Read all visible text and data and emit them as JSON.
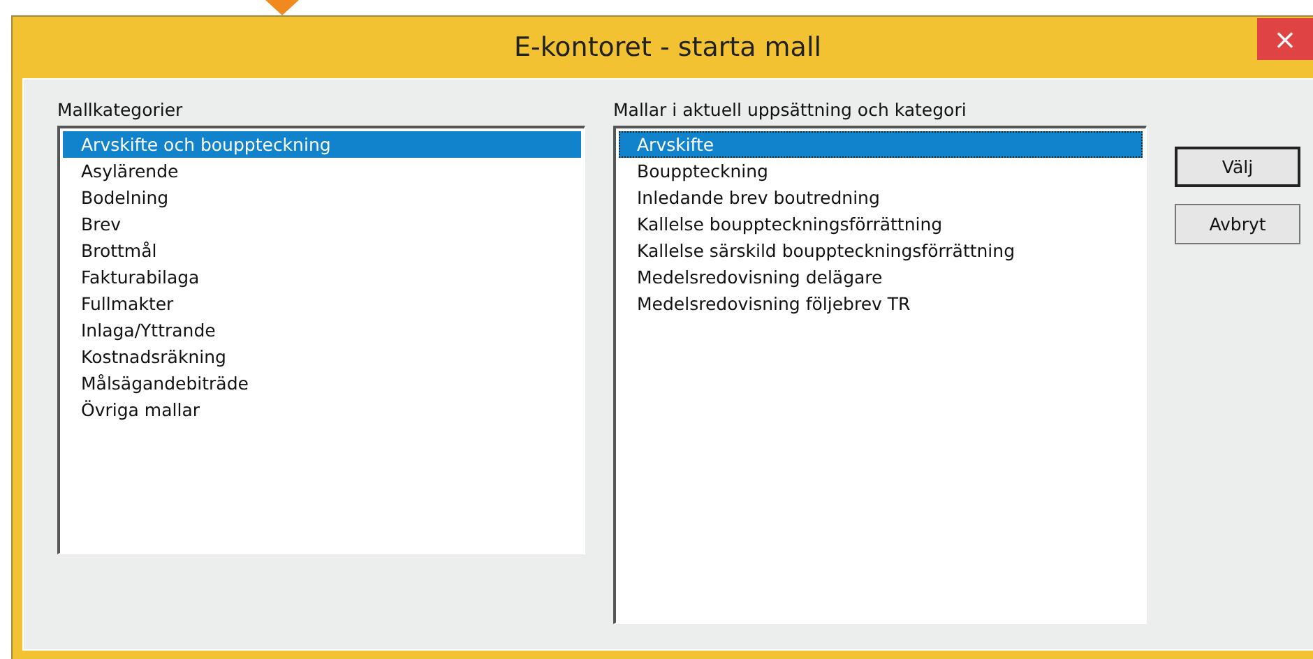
{
  "window": {
    "title": "E-kontoret - starta mall",
    "close": "×"
  },
  "categories": {
    "label": "Mallkategorier",
    "items": [
      {
        "label": "Arvskifte och bouppteckning",
        "selected": true
      },
      {
        "label": "Asylärende",
        "selected": false
      },
      {
        "label": "Bodelning",
        "selected": false
      },
      {
        "label": "Brev",
        "selected": false
      },
      {
        "label": "Brottmål",
        "selected": false
      },
      {
        "label": "Fakturabilaga",
        "selected": false
      },
      {
        "label": "Fullmakter",
        "selected": false
      },
      {
        "label": "Inlaga/Yttrande",
        "selected": false
      },
      {
        "label": "Kostnadsräkning",
        "selected": false
      },
      {
        "label": "Målsägandebiträde",
        "selected": false
      },
      {
        "label": "Övriga mallar",
        "selected": false
      }
    ]
  },
  "templates": {
    "label": "Mallar i aktuell uppsättning och kategori",
    "items": [
      {
        "label": "Arvskifte",
        "selected": true
      },
      {
        "label": "Bouppteckning",
        "selected": false
      },
      {
        "label": "Inledande brev boutredning",
        "selected": false
      },
      {
        "label": "Kallelse bouppteckningsförrättning",
        "selected": false
      },
      {
        "label": "Kallelse särskild bouppteckningsförrättning",
        "selected": false
      },
      {
        "label": "Medelsredovisning delägare",
        "selected": false
      },
      {
        "label": "Medelsredovisning följebrev TR",
        "selected": false
      }
    ]
  },
  "buttons": [
    {
      "label": "Välj",
      "default": true
    },
    {
      "label": "Avbryt",
      "default": false
    }
  ]
}
